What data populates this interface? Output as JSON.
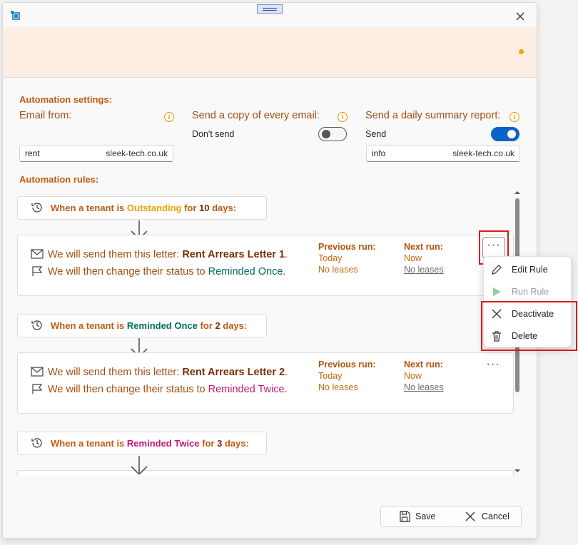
{
  "settings": {
    "section_title": "Automation settings:",
    "email_from": {
      "label": "Email from:",
      "value": "rent",
      "domain": "sleek-tech.co.uk"
    },
    "copy": {
      "label": "Send a copy of every email:",
      "toggle_text": "Don't send",
      "enabled": false
    },
    "summary": {
      "label": "Send a daily summary report:",
      "toggle_text": "Send",
      "enabled": true,
      "value": "info",
      "domain": "sleek-tech.co.uk"
    }
  },
  "rules_title": "Automation rules:",
  "rules": [
    {
      "trigger": {
        "prefix": "When a tenant is ",
        "status": "Outstanding",
        "mid": " for ",
        "days": "10",
        "suffix": " days:"
      },
      "letter_prefix": "We will send them this letter: ",
      "letter": "Rent Arrears Letter 1",
      "letter_suffix": ".",
      "status_prefix": "We will then change their status to ",
      "new_status": "Reminded Once",
      "status_suffix": ".",
      "prev_label": "Previous run:",
      "prev_when": "Today",
      "prev_result": "No leases",
      "next_label": "Next run:",
      "next_when": "Now",
      "next_result": "No leases"
    },
    {
      "trigger": {
        "prefix": "When a tenant is ",
        "status": "Reminded Once",
        "mid": " for ",
        "days": "2",
        "suffix": " days:"
      },
      "letter_prefix": "We will send them this letter: ",
      "letter": "Rent Arrears Letter 2",
      "letter_suffix": ".",
      "status_prefix": "We will then change their status to ",
      "new_status": "Reminded Twice",
      "status_suffix": ".",
      "prev_label": "Previous run:",
      "prev_when": "Today",
      "prev_result": "No leases",
      "next_label": "Next run:",
      "next_when": "Now",
      "next_result": "No leases"
    },
    {
      "trigger": {
        "prefix": "When a tenant is ",
        "status": "Reminded Twice",
        "mid": " for ",
        "days": "3",
        "suffix": " days:"
      }
    }
  ],
  "menu": {
    "more_label": "···",
    "items": [
      {
        "label": "Edit Rule",
        "icon": "pencil-icon",
        "enabled": true
      },
      {
        "label": "Run Rule",
        "icon": "play-icon",
        "enabled": false
      },
      {
        "label": "Deactivate",
        "icon": "x-icon",
        "enabled": true
      },
      {
        "label": "Delete",
        "icon": "trash-icon",
        "enabled": true
      }
    ]
  },
  "footer": {
    "save": "Save",
    "cancel": "Cancel"
  },
  "colors": {
    "accent": "#c05a12",
    "outstanding": "#f0a000",
    "reminded_once": "#006d5b",
    "reminded_twice": "#c2187a",
    "toggle_on": "#0a64c8",
    "highlight": "#e01818"
  }
}
